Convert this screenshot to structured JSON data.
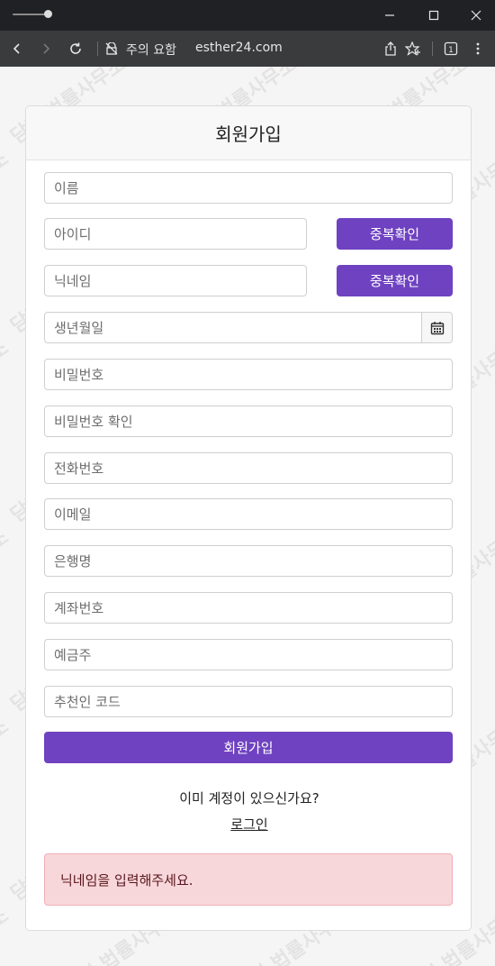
{
  "browser": {
    "security_label": "주의 요함",
    "url": "esther24.com",
    "tab_count": "1"
  },
  "watermark_text": "담덕 법률사무소",
  "form": {
    "title": "회원가입",
    "fields": {
      "name": "이름",
      "id": "아이디",
      "nickname": "닉네임",
      "birthdate": "생년월일",
      "password": "비밀번호",
      "password_confirm": "비밀번호 확인",
      "phone": "전화번호",
      "email": "이메일",
      "bank": "은행명",
      "account": "계좌번호",
      "holder": "예금주",
      "referrer": "추천인 코드"
    },
    "dup_check_label": "중복확인",
    "submit_label": "회원가입",
    "login_question": "이미 계정이 있으신가요?",
    "login_link": "로그인",
    "alert_message": "닉네임을 입력해주세요."
  },
  "colors": {
    "accent": "#6f42c1",
    "alert_bg": "#f8d7da",
    "alert_text": "#58151c"
  },
  "icons": [
    "minimize-icon",
    "maximize-icon",
    "close-icon",
    "back-icon",
    "forward-icon",
    "reload-icon",
    "not-secure-icon",
    "share-icon",
    "favorite-icon",
    "tab-count-icon",
    "more-menu-icon",
    "calendar-icon"
  ]
}
